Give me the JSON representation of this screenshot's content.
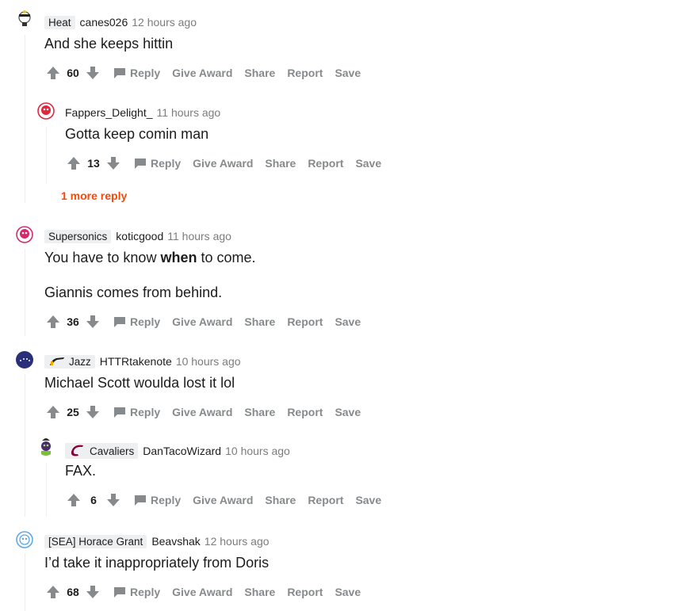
{
  "actions": {
    "reply": "Reply",
    "give_award": "Give Award",
    "share": "Share",
    "report": "Report",
    "save": "Save"
  },
  "comments": [
    {
      "flair": "Heat",
      "author": "canes026",
      "time": "12 hours ago",
      "body": [
        "And she keeps hittin"
      ],
      "score": "60"
    },
    {
      "flair": "",
      "author": "Fappers_Delight_",
      "time": "11 hours ago",
      "body": [
        "Gotta keep comin man"
      ],
      "score": "13"
    },
    {
      "flair": "Supersonics",
      "author": "koticgood",
      "time": "11 hours ago",
      "body_pre": "You have to know ",
      "body_bold": "when",
      "body_post": " to come.",
      "body2": "Giannis comes from behind.",
      "score": "36"
    },
    {
      "flair": "Jazz",
      "author": "HTTRtakenote",
      "time": "10 hours ago",
      "body": [
        "Michael Scott woulda lost it lol"
      ],
      "score": "25"
    },
    {
      "flair": "Cavaliers",
      "author": "DanTacoWizard",
      "time": "10 hours ago",
      "body": [
        "FAX."
      ],
      "score": "6"
    },
    {
      "flair": "[SEA] Horace Grant",
      "author": "Beavshak",
      "time": "12 hours ago",
      "body": [
        "I’d take it inappropriately from Doris"
      ],
      "score": "68"
    }
  ],
  "more_replies": "1 more reply",
  "colors": {
    "accent": "#ff4500",
    "meta": "#7c7c7c",
    "action": "#878a8c"
  }
}
